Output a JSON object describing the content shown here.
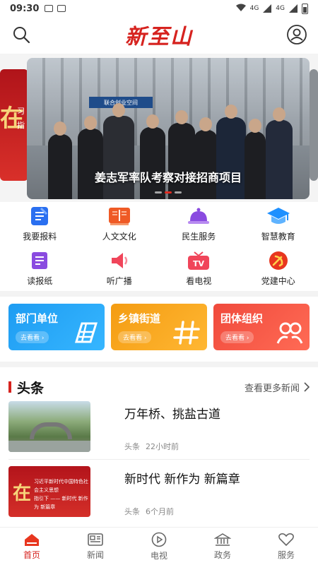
{
  "status_bar": {
    "time": "09:30",
    "network_1": "4G",
    "network_2": "4G"
  },
  "header": {
    "logo": "新至山",
    "search_icon": "search-icon",
    "profile_icon": "user-icon"
  },
  "banner": {
    "title": "姜志军率队考察对接招商项目",
    "shop_sign": "联合创业空间",
    "side_left_char": "在",
    "side_left_lines": [
      "习",
      "指"
    ],
    "active_dot": 2,
    "dot_count": 3
  },
  "grid": [
    {
      "label": "我要报料",
      "icon": "report-icon",
      "color": "#2a6ff0"
    },
    {
      "label": "人文文化",
      "icon": "book-icon",
      "color": "#ef5a25"
    },
    {
      "label": "民生服务",
      "icon": "service-bell-icon",
      "color": "#8a4be0"
    },
    {
      "label": "智慧教育",
      "icon": "graduation-cap-icon",
      "color": "#1e90ff"
    },
    {
      "label": "读报纸",
      "icon": "newspaper-icon",
      "color": "#8a4be0"
    },
    {
      "label": "听广播",
      "icon": "broadcast-icon",
      "color": "#f0455a"
    },
    {
      "label": "看电视",
      "icon": "tv-icon",
      "color": "#f0455a"
    },
    {
      "label": "党建中心",
      "icon": "party-emblem-icon",
      "color": "#e8361f"
    }
  ],
  "cards": [
    {
      "title": "部门单位",
      "sub": "去看看 ›",
      "color": "blue"
    },
    {
      "title": "乡镇街道",
      "sub": "去看看 ›",
      "color": "orange"
    },
    {
      "title": "团体组织",
      "sub": "去看看 ›",
      "color": "red"
    }
  ],
  "section": {
    "title": "头条",
    "more": "查看更多新闻"
  },
  "news": [
    {
      "title": "万年桥、挑盐古道",
      "tag": "头条",
      "time": "22小时前"
    },
    {
      "title": "新时代 新作为 新篇章",
      "tag": "头条",
      "time": "6个月前"
    }
  ],
  "news_thumb2": {
    "char": "在",
    "line1": "习近平新时代中国特色社会主义思想",
    "line2": "指引下 —— 新时代 新作为 新篇章"
  },
  "tabs": [
    {
      "label": "首页",
      "icon": "home-icon",
      "active": true
    },
    {
      "label": "新闻",
      "icon": "news-icon",
      "active": false
    },
    {
      "label": "电视",
      "icon": "play-icon",
      "active": false
    },
    {
      "label": "政务",
      "icon": "government-icon",
      "active": false
    },
    {
      "label": "服务",
      "icon": "heart-icon",
      "active": false
    }
  ],
  "colors": {
    "brand_red": "#d6231f"
  }
}
